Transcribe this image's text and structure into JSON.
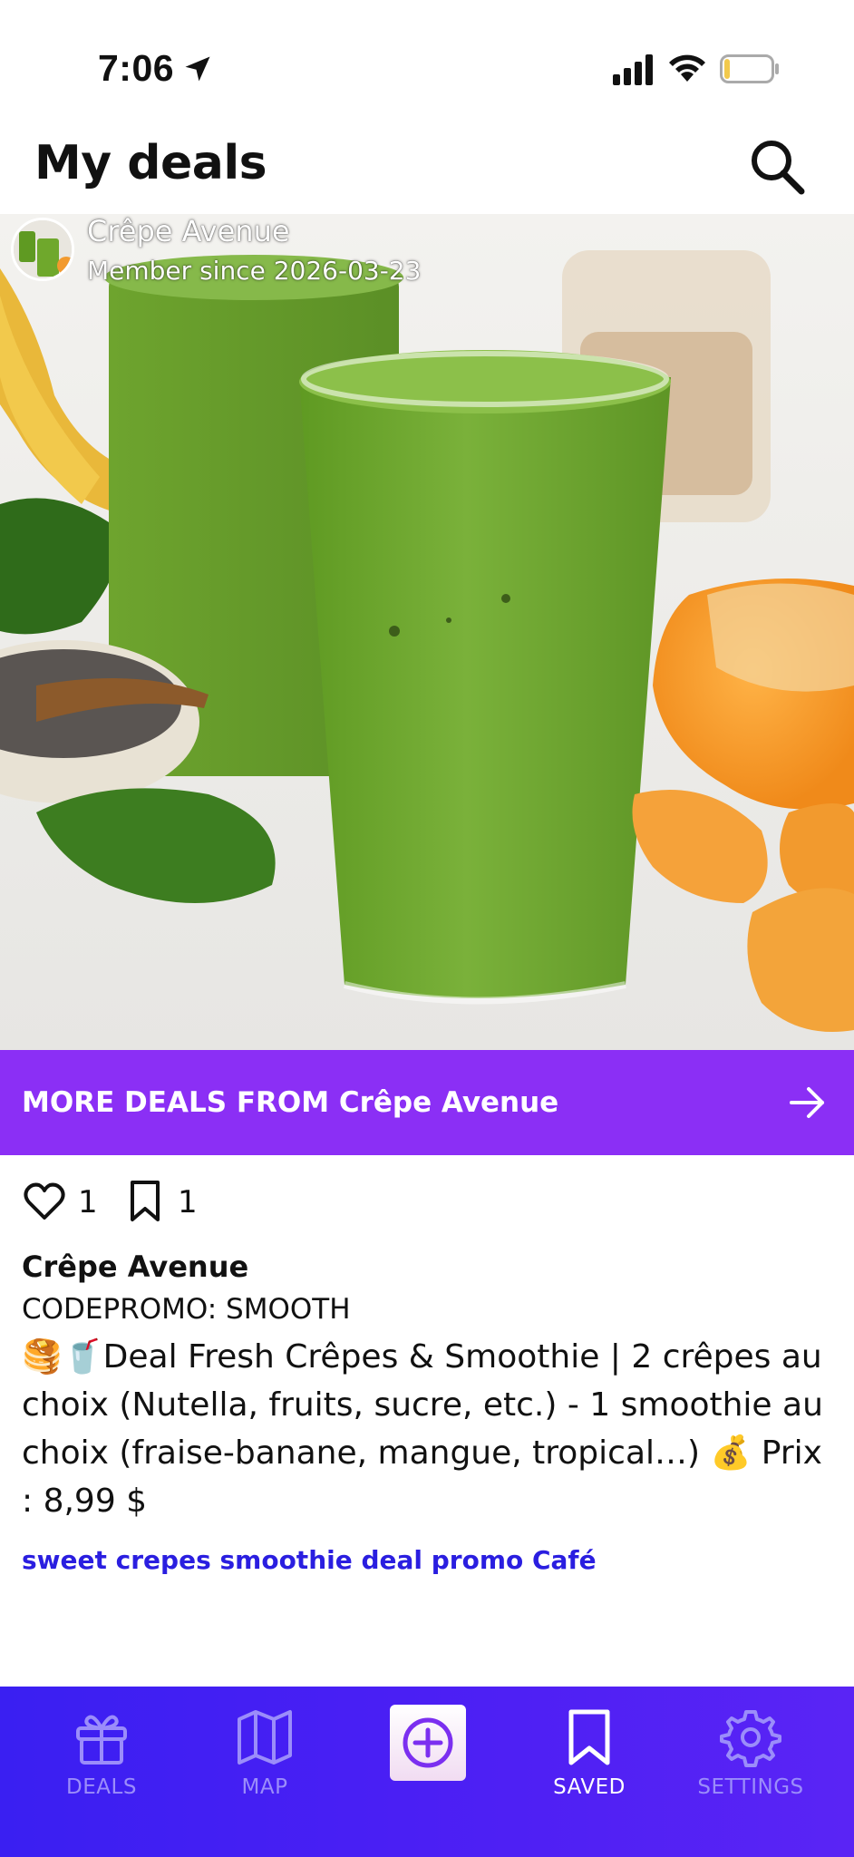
{
  "status_bar": {
    "time": "7:06",
    "icons": [
      "location-arrow-icon",
      "cellular-signal-icon",
      "wifi-icon",
      "battery-icon"
    ]
  },
  "header": {
    "title": "My deals",
    "search_icon": "search-icon"
  },
  "deal": {
    "merchant_name": "Crêpe Avenue",
    "member_since": "Member since 2026-03-23",
    "more_deals_label": "MORE DEALS FROM Crêpe Avenue",
    "likes": "1",
    "saves": "1",
    "promo_code": "CODEPROMO: SMOOTH",
    "description": "🥞🥤Deal Fresh Crêpes & Smoothie | 2 crêpes au choix (Nutella, fruits, sucre, etc.) - 1 smoothie au choix (fraise-banane, mangue, tropical…) 💰 Prix : 8,99 $",
    "tags": "sweet crepes smoothie deal promo Café"
  },
  "bottom_nav": {
    "items": [
      {
        "label": "DEALS",
        "icon": "gift-icon",
        "active": false
      },
      {
        "label": "MAP",
        "icon": "map-icon",
        "active": false
      },
      {
        "label": "",
        "icon": "add-circle-icon",
        "active": false
      },
      {
        "label": "SAVED",
        "icon": "bookmark-icon",
        "active": true
      },
      {
        "label": "SETTINGS",
        "icon": "gear-icon",
        "active": false
      }
    ]
  },
  "colors": {
    "banner_purple": "#8b2ff5",
    "nav_blue": "#3a1ff2",
    "tag_blue": "#2a1ee0",
    "nav_inactive": "#9b8dfa"
  }
}
